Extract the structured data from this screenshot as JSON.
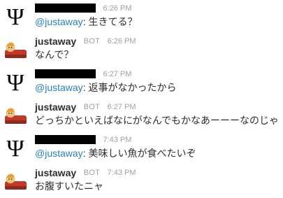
{
  "messages": [
    {
      "author": "",
      "bot_label": "",
      "time": "6:26 PM",
      "mention": "@justaway",
      "separator": ": ",
      "text": "生きてる？",
      "avatar_icon": "psi-icon"
    },
    {
      "author": "justaway",
      "bot_label": "BOT",
      "time": "6:26 PM",
      "mention": "",
      "separator": "",
      "text": "なんで？",
      "avatar_icon": "sleeping-figure-icon"
    },
    {
      "author": "",
      "bot_label": "",
      "time": "6:27 PM",
      "mention": "@justaway",
      "separator": ": ",
      "text": "返事がなかったから",
      "avatar_icon": "psi-icon"
    },
    {
      "author": "justaway",
      "bot_label": "BOT",
      "time": "6:27 PM",
      "mention": "",
      "separator": "",
      "text": "どっちかといえばなにがなんでもかなあーーーなのじゃ",
      "avatar_icon": "sleeping-figure-icon"
    },
    {
      "author": "",
      "bot_label": "",
      "time": "7:43 PM",
      "mention": "@justaway",
      "separator": ": ",
      "text": "美味しい魚が食べたいぞ",
      "avatar_icon": "psi-icon"
    },
    {
      "author": "justaway",
      "bot_label": "BOT",
      "time": "7:43 PM",
      "mention": "",
      "separator": "",
      "text": "お腹すいたニャ",
      "avatar_icon": "sleeping-figure-icon"
    }
  ],
  "colors": {
    "mention": "#2a80b9",
    "timestamp": "#a0a0a2",
    "text": "#2c2d30",
    "redaction": "#000000"
  }
}
